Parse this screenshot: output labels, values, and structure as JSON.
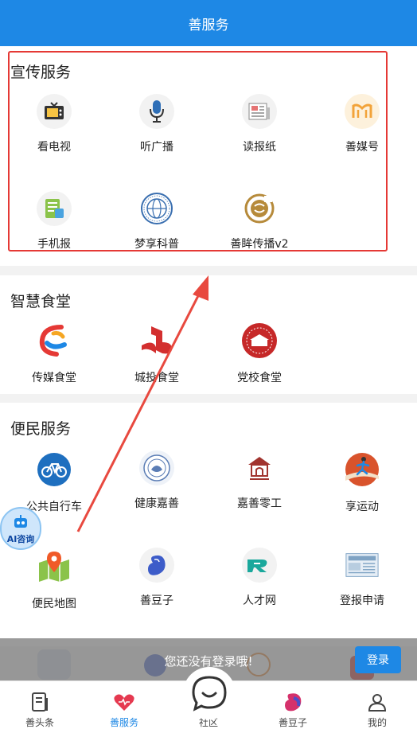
{
  "header": {
    "title": "善服务"
  },
  "sections": [
    {
      "title": "宣传服务",
      "items": [
        {
          "label": "看电视",
          "icon": "tv-icon"
        },
        {
          "label": "听广播",
          "icon": "microphone-icon"
        },
        {
          "label": "读报纸",
          "icon": "newspaper-icon"
        },
        {
          "label": "善媒号",
          "icon": "shanmei-logo-icon"
        },
        {
          "label": "手机报",
          "icon": "mobile-newspaper-icon"
        },
        {
          "label": "梦享科普",
          "icon": "science-globe-icon"
        },
        {
          "label": "善眸传播v2",
          "icon": "seal-stamp-icon"
        }
      ]
    },
    {
      "title": "智慧食堂",
      "items": [
        {
          "label": "传媒食堂",
          "icon": "media-canteen-logo-icon"
        },
        {
          "label": "城投食堂",
          "icon": "city-investment-logo-icon"
        },
        {
          "label": "党校食堂",
          "icon": "party-school-logo-icon"
        }
      ]
    },
    {
      "title": "便民服务",
      "items": [
        {
          "label": "公共自行车",
          "icon": "bicycle-icon"
        },
        {
          "label": "健康嘉善",
          "icon": "health-emblem-icon"
        },
        {
          "label": "嘉善零工",
          "icon": "odd-jobs-icon"
        },
        {
          "label": "享运动",
          "icon": "runner-icon"
        },
        {
          "label": "便民地图",
          "icon": "map-pin-icon"
        },
        {
          "label": "善豆子",
          "icon": "bean-icon"
        },
        {
          "label": "人才网",
          "icon": "talent-network-icon"
        },
        {
          "label": "登报申请",
          "icon": "news-application-icon"
        }
      ]
    }
  ],
  "ai_badge": {
    "label": "AI咨询"
  },
  "login_banner": {
    "message": "您还没有登录哦!",
    "button": "登录"
  },
  "tabbar": [
    {
      "label": "善头条",
      "icon": "document-icon",
      "active": false
    },
    {
      "label": "善服务",
      "icon": "heart-icon",
      "active": true
    },
    {
      "label": "社区",
      "icon": "chat-bubble-icon",
      "active": false
    },
    {
      "label": "善豆子",
      "icon": "bean-icon",
      "active": false
    },
    {
      "label": "我的",
      "icon": "user-icon",
      "active": false
    }
  ],
  "colors": {
    "primary": "#1e88e5",
    "annotation": "#e53935"
  }
}
